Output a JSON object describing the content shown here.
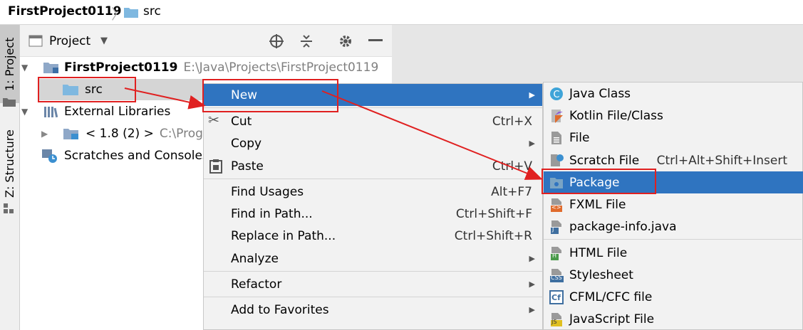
{
  "breadcrumb": {
    "project": "FirstProject0119",
    "folder": "src"
  },
  "side_tabs": {
    "project": "1: Project",
    "structure": "Z: Structure"
  },
  "panel": {
    "title": "Project"
  },
  "tree": {
    "root_name": "FirstProject0119",
    "root_path": "E:\\Java\\Projects\\FirstProject0119",
    "src": "src",
    "external_libraries": "External Libraries",
    "jdk_name": "< 1.8 (2) >",
    "jdk_path": "C:\\Progra",
    "scratches": "Scratches and Consoles"
  },
  "context_menu": [
    {
      "label": "New",
      "shortcut": "",
      "submenu": true,
      "highlighted": true
    },
    {
      "label": "Cut",
      "shortcut": "Ctrl+X",
      "icon": "scissors-icon"
    },
    {
      "label": "Copy",
      "shortcut": "",
      "submenu": true
    },
    {
      "label": "Paste",
      "shortcut": "Ctrl+V",
      "icon": "clipboard-icon"
    },
    {
      "label": "Find Usages",
      "shortcut": "Alt+F7"
    },
    {
      "label": "Find in Path...",
      "shortcut": "Ctrl+Shift+F"
    },
    {
      "label": "Replace in Path...",
      "shortcut": "Ctrl+Shift+R"
    },
    {
      "label": "Analyze",
      "shortcut": "",
      "submenu": true
    },
    {
      "label": "Refactor",
      "shortcut": "",
      "submenu": true
    },
    {
      "label": "Add to Favorites",
      "shortcut": "",
      "submenu": true
    }
  ],
  "new_submenu": [
    {
      "label": "Java Class",
      "icon": "java-class-icon"
    },
    {
      "label": "Kotlin File/Class",
      "icon": "kotlin-icon"
    },
    {
      "label": "File",
      "icon": "file-icon"
    },
    {
      "label": "Scratch File",
      "shortcut": "Ctrl+Alt+Shift+Insert",
      "icon": "scratch-file-icon"
    },
    {
      "label": "Package",
      "icon": "package-icon",
      "highlighted": true
    },
    {
      "label": "FXML File",
      "icon": "fxml-icon",
      "badge": "<>"
    },
    {
      "label": "package-info.java",
      "icon": "package-info-icon",
      "badge": "J"
    },
    {
      "label": "HTML File",
      "icon": "html-icon",
      "badge": "H"
    },
    {
      "label": "Stylesheet",
      "icon": "css-icon",
      "badge": "CSS"
    },
    {
      "label": "CFML/CFC file",
      "icon": "cfml-icon",
      "badge": "Cf"
    },
    {
      "label": "JavaScript File",
      "icon": "javascript-icon",
      "badge": "JS"
    }
  ],
  "colors": {
    "highlight": "#2f74c0",
    "annotation": "#e02020",
    "folder": "#7fb8e0"
  }
}
